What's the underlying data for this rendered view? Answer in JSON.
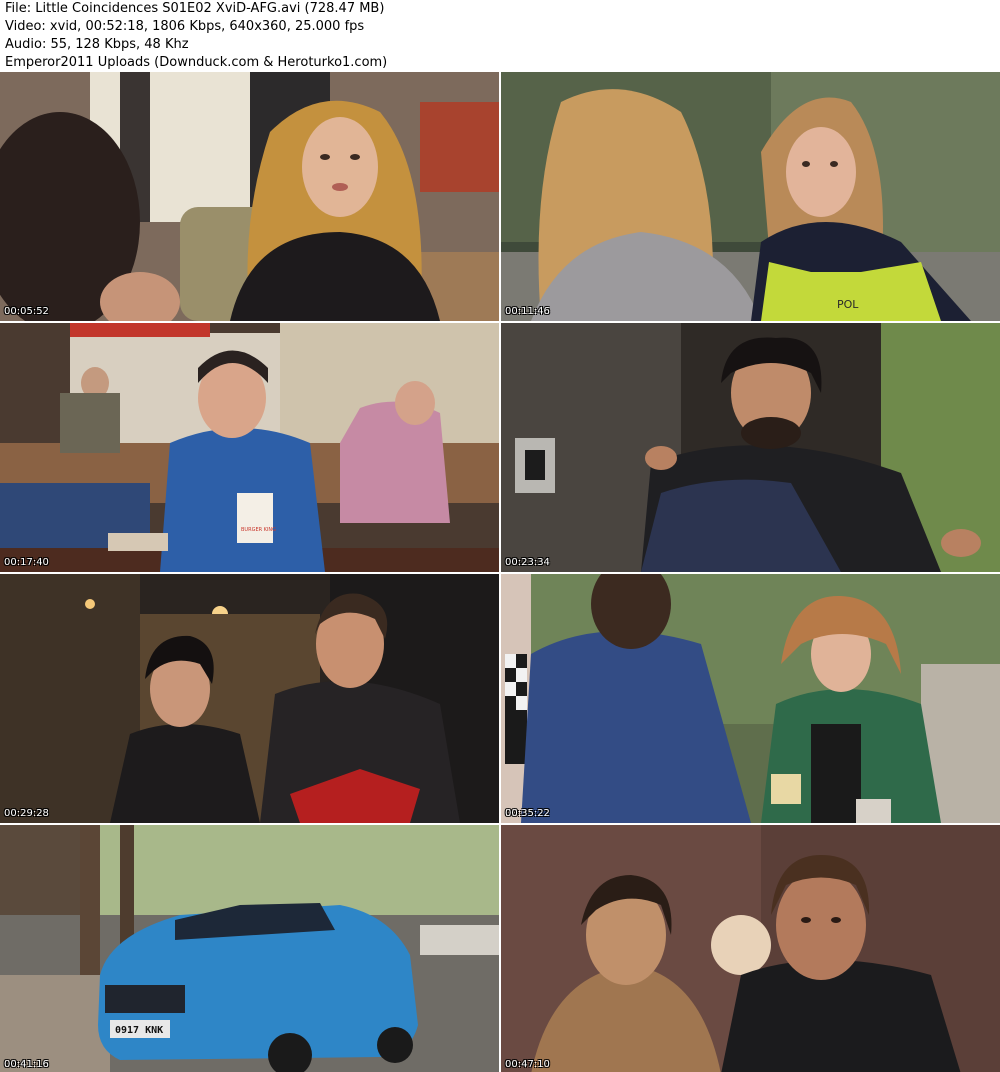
{
  "header": {
    "file_line": "File: Little Coincidences S01E02 XviD-AFG.avi (728.47 MB)",
    "video_line": "Video: xvid, 00:52:18, 1806 Kbps, 640x360, 25.000 fps",
    "audio_line": "Audio: 55, 128 Kbps, 48 Khz",
    "uploader_line": "Emperor2011 Uploads (Downduck.com & Heroturko1.com)"
  },
  "thumbnails": [
    {
      "timestamp": "00:05:52"
    },
    {
      "timestamp": "00:11:46"
    },
    {
      "timestamp": "00:17:40"
    },
    {
      "timestamp": "00:23:34"
    },
    {
      "timestamp": "00:29:28"
    },
    {
      "timestamp": "00:35:22"
    },
    {
      "timestamp": "00:41:16"
    },
    {
      "timestamp": "00:47:10"
    }
  ],
  "scene_text": {
    "cup_brand": "BURGER KING",
    "license_plate": "0917 KNK",
    "vest_text": "POL"
  }
}
